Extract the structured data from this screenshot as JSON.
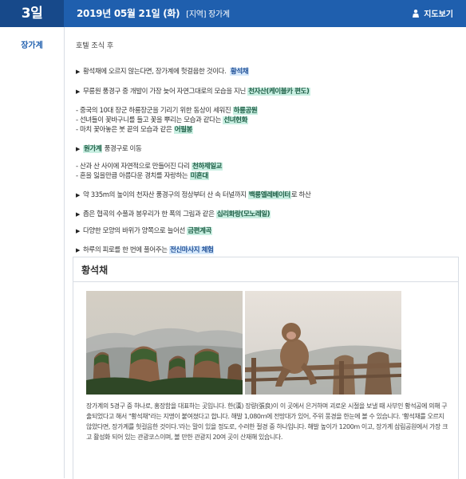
{
  "header": {
    "day": "3일",
    "date": "2019년 05월 21일 (화)",
    "region": "[지역] 장가계",
    "map_label": "지도보기"
  },
  "sidebar": {
    "city": "장가계"
  },
  "schedule": {
    "hotel_note": "호텔 조식 후",
    "items": [
      {
        "text": "황석채에 오르지 않는다면, 장가계에 헛걸음한 것이다.",
        "highlight": "황석채",
        "style": "blue"
      },
      {
        "text": "무릉원 풍경구 중 개발이 가장 늦어 자연그대로의 모습을 지닌",
        "highlight": "천자산(케이블카 편도)",
        "style": "green"
      }
    ],
    "subs_1": [
      {
        "text": "- 중국의 10대 장군 하룡장군을 기리기 위한 동상이 세워진",
        "highlight": "하룡공원",
        "style": "green"
      },
      {
        "text": "- 선녀들이 꽃바구니를 들고 꽃을 뿌리는 모습과 같다는",
        "highlight": "선녀헌화",
        "style": "green"
      },
      {
        "text": "- 마치 꽃아놓은 붓 끝의 모습과 같은",
        "highlight": "어필봉",
        "style": "green"
      }
    ],
    "item3": {
      "highlight": "원가계",
      "text": "풍경구로 이동",
      "style": "green"
    },
    "subs_2": [
      {
        "text": "- 산과 산 사이에 자연적으로 만들어진 다리",
        "highlight": "천하제일교",
        "style": "green"
      },
      {
        "text": "- 혼을 잃을만큼 아름다운 경치를 자랑하는",
        "highlight": "미혼대",
        "style": "green"
      }
    ],
    "items_b": [
      {
        "text": "약 335m의 높이의 천자산 풍경구의 정상부터 산 속 터널까지",
        "highlight": "백룡엘레베이터",
        "after": "로 하산",
        "style": "green"
      },
      {
        "text": "좁은 협곡의 수풀과 봉우리가 한 폭의 그림과 같은",
        "highlight": "십리화랑(모노레일)",
        "after": "",
        "style": "green"
      },
      {
        "text": "다양한 모양의 바위가 양쪽으로 늘어선",
        "highlight": "금편계곡",
        "after": "",
        "style": "green"
      },
      {
        "text": "하루의 피로를 한 번에 풀어주는",
        "highlight": "전신마사지 체험",
        "after": "",
        "style": "blue"
      }
    ]
  },
  "card": {
    "title": "황석채",
    "description": "장가계의 5경구 중 하나로, 홍장함을 대표하는 곳입니다. 한(漢) 장량(張良)이 이 곳에서 은거하며 괴로운 시절을 보낼 때 사부인 황석공에 의해 구출되었다고 해서 \"황석채\"라는 지명이 붙여졌다고 합니다. 해발 1,080m에 전망대가 있어, 주위 풍경을 한눈에 볼 수 있습니다. '황석채를 오르지 않았다면, 장가계를 헛걸음한 것이다.'라는 말이 있을 정도로, 수려한 절경 중 하나입니다. 해발 높이가 1200m 이고, 장가계 삼림공원에서 가장 크고 활성화 되어 있는 관광코스이며, 볼 만한 관광지 20여 곳이 산재해 있습니다."
  },
  "colors": {
    "header": "#1f5fae",
    "header_dark": "#17498a",
    "highlight_blue_bg": "#d7e9fb",
    "highlight_green_bg": "#c9efe2"
  },
  "icons": {
    "map": "person-pin-icon",
    "bullet": "triangle-right-icon"
  }
}
